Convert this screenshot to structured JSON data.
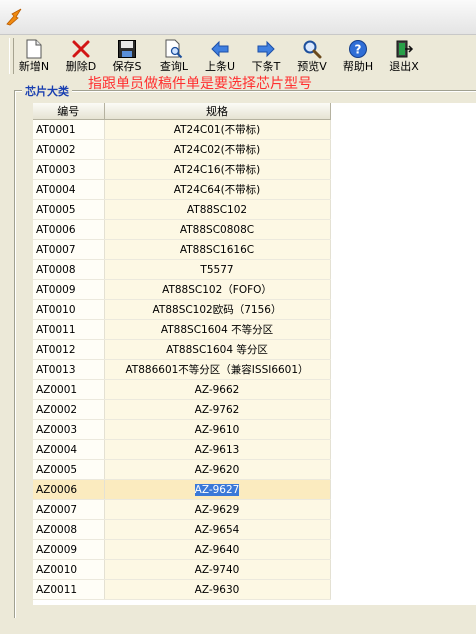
{
  "toolbar": {
    "buttons": [
      {
        "label": "新增N",
        "icon": "new-icon"
      },
      {
        "label": "删除D",
        "icon": "delete-icon"
      },
      {
        "label": "保存S",
        "icon": "save-icon"
      },
      {
        "label": "查询L",
        "icon": "search-doc-icon"
      },
      {
        "label": "上条U",
        "icon": "arrow-left-icon"
      },
      {
        "label": "下条T",
        "icon": "arrow-right-icon"
      },
      {
        "label": "预览V",
        "icon": "magnifier-icon"
      },
      {
        "label": "帮助H",
        "icon": "help-icon"
      },
      {
        "label": "退出X",
        "icon": "exit-icon"
      }
    ]
  },
  "hint": "指跟单员做稿件单是要选择芯片型号",
  "group": {
    "label": "芯片大类"
  },
  "table": {
    "headers": [
      "编号",
      "规格"
    ],
    "selected_index": 18,
    "rows": [
      [
        "AT0001",
        "AT24C01(不带标)"
      ],
      [
        "AT0002",
        "AT24C02(不带标)"
      ],
      [
        "AT0003",
        "AT24C16(不带标)"
      ],
      [
        "AT0004",
        "AT24C64(不带标)"
      ],
      [
        "AT0005",
        "AT88SC102"
      ],
      [
        "AT0006",
        "AT88SC0808C"
      ],
      [
        "AT0007",
        "AT88SC1616C"
      ],
      [
        "AT0008",
        "T5577"
      ],
      [
        "AT0009",
        "AT88SC102（FOFO）"
      ],
      [
        "AT0010",
        "AT88SC102欧码（7156）"
      ],
      [
        "AT0011",
        "AT88SC1604 不等分区"
      ],
      [
        "AT0012",
        "AT88SC1604 等分区"
      ],
      [
        "AT0013",
        "AT886601不等分区（兼容ISSI6601）"
      ],
      [
        "AZ0001",
        "AZ-9662"
      ],
      [
        "AZ0002",
        "AZ-9762"
      ],
      [
        "AZ0003",
        "AZ-9610"
      ],
      [
        "AZ0004",
        "AZ-9613"
      ],
      [
        "AZ0005",
        "AZ-9620"
      ],
      [
        "AZ0006",
        "AZ-9627"
      ],
      [
        "AZ0007",
        "AZ-9629"
      ],
      [
        "AZ0008",
        "AZ-9654"
      ],
      [
        "AZ0009",
        "AZ-9640"
      ],
      [
        "AZ0010",
        "AZ-9740"
      ],
      [
        "AZ0011",
        "AZ-9630"
      ]
    ]
  },
  "colors": {
    "hint_text": "#ff3030",
    "group_label": "#1a3fb0",
    "selected_row": "#fbebbf",
    "selected_cell": "#3a78d8"
  }
}
